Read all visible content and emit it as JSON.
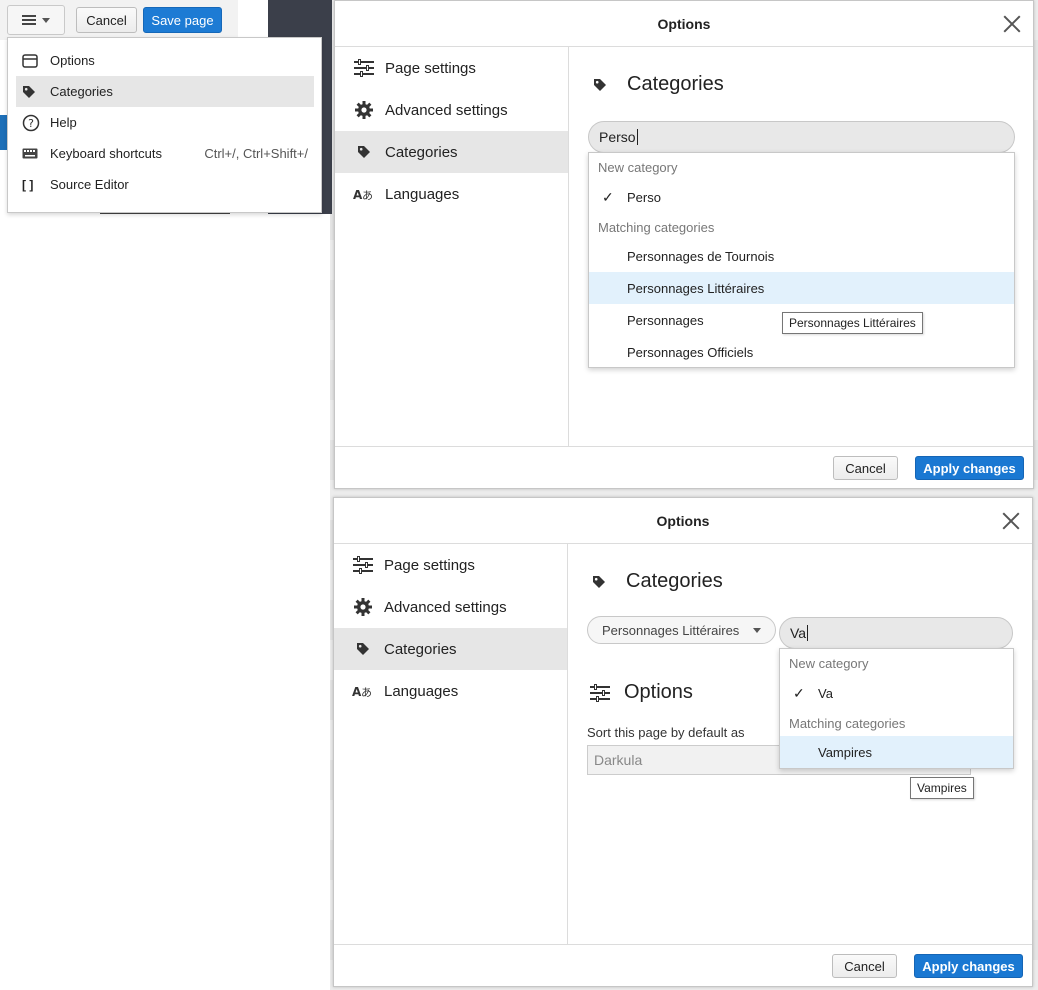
{
  "toolbar": {
    "cancel_label": "Cancel",
    "save_label": "Save page"
  },
  "menu": {
    "items": [
      {
        "label": "Options",
        "icon": "window-icon"
      },
      {
        "label": "Categories",
        "icon": "tag-icon",
        "active": true
      },
      {
        "label": "Help",
        "icon": "help-icon"
      },
      {
        "label": "Keyboard shortcuts",
        "icon": "keyboard-icon",
        "shortcut": "Ctrl+/, Ctrl+Shift+/"
      },
      {
        "label": "Source Editor",
        "icon": "brackets-icon",
        "icon_text": "[ ]"
      }
    ]
  },
  "dialog1": {
    "title": "Options",
    "sidebar": [
      "Page settings",
      "Advanced settings",
      "Categories",
      "Languages"
    ],
    "active_sidebar": "Categories",
    "section_title": "Categories",
    "input_value": "Perso",
    "popup": {
      "new_header": "New category",
      "new_value": "Perso",
      "check": "✓",
      "matching_header": "Matching categories",
      "matches": [
        "Personnages de Tournois",
        "Personnages Littéraires",
        "Personnages",
        "Personnages Officiels"
      ],
      "highlighted": "Personnages Littéraires"
    },
    "tooltip": "Personnages Littéraires",
    "cancel_label": "Cancel",
    "apply_label": "Apply changes"
  },
  "dialog2": {
    "title": "Options",
    "sidebar": [
      "Page settings",
      "Advanced settings",
      "Categories",
      "Languages"
    ],
    "active_sidebar": "Categories",
    "section_title": "Categories",
    "chip_label": "Personnages Littéraires",
    "input_value": "Va",
    "options_title": "Options",
    "sort_label": "Sort this page by default as",
    "sort_value": "Darkula",
    "popup": {
      "new_header": "New category",
      "new_value": "Va",
      "check": "✓",
      "matching_header": "Matching categories",
      "matches": [
        "Vampires"
      ],
      "highlighted": "Vampires"
    },
    "tooltip": "Vampires",
    "cancel_label": "Cancel",
    "apply_label": "Apply changes"
  },
  "colors": {
    "accent": "#1a78d2",
    "highlight": "#e2f1fc",
    "active_bg": "#e6e6e6"
  }
}
